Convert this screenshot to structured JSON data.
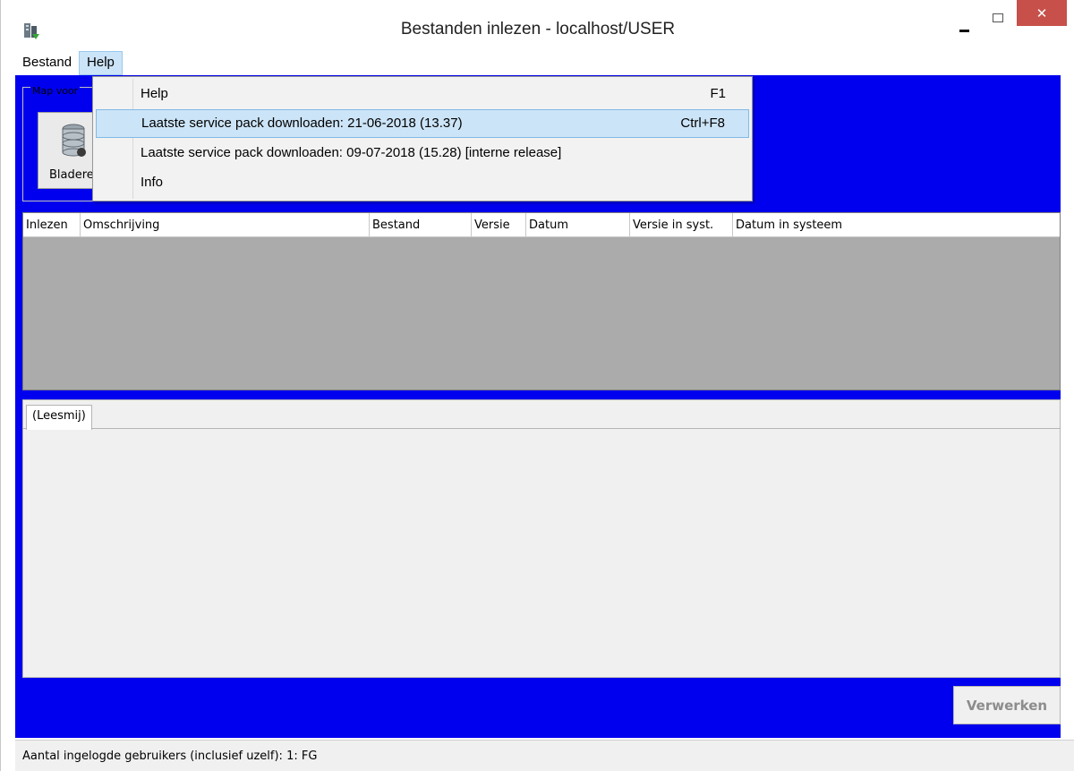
{
  "window": {
    "title": "Bestanden inlezen - localhost/USER",
    "close_symbol": "✕"
  },
  "menu": {
    "bestand": "Bestand",
    "help": "Help"
  },
  "help_menu": [
    {
      "label": "Help",
      "shortcut": "F1"
    },
    {
      "label": "Laatste service pack downloaden: 21-06-2018 (13.37)",
      "shortcut": "Ctrl+F8",
      "highlighted": true
    },
    {
      "label": "Laatste service pack downloaden: 09-07-2018 (15.28) [interne release]",
      "shortcut": ""
    },
    {
      "label": "Info",
      "shortcut": ""
    }
  ],
  "group": {
    "label": "Map voor",
    "browse_label": "Bladeren"
  },
  "table": {
    "columns": [
      "Inlezen",
      "Omschrijving",
      "Bestand",
      "Versie",
      "Datum",
      "Versie in syst.",
      "Datum in systeem"
    ]
  },
  "tabs": {
    "leesmij": "(Leesmij)"
  },
  "process_button": "Verwerken",
  "status": {
    "text": "Aantal ingelogde gebruikers (inclusief uzelf): 1: FG"
  },
  "colors": {
    "client_bg": "#0000ee",
    "table_bg": "#ababab",
    "highlight": "#cce4f7"
  }
}
